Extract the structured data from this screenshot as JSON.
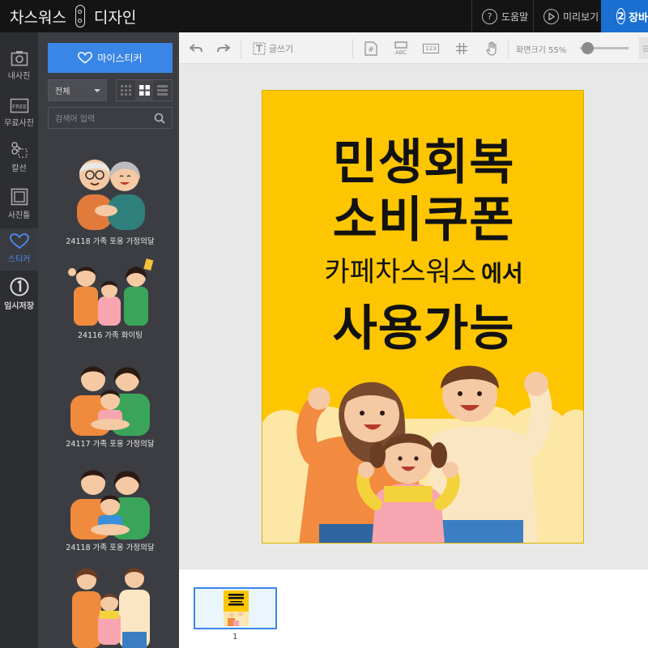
{
  "app": {
    "brand_left": "차스워스",
    "brand_right": "디자인"
  },
  "topbar": {
    "help_label": "도움말",
    "help_icon": "?",
    "preview_label": "미리보기",
    "step2_number": "2",
    "step2_label": "장바"
  },
  "rail": {
    "items": [
      {
        "label": "내사진",
        "icon": "camera-icon"
      },
      {
        "label": "무료사진",
        "icon": "free-photo-icon"
      },
      {
        "label": "칼선",
        "icon": "scissors-icon"
      },
      {
        "label": "사진틀",
        "icon": "frame-icon"
      },
      {
        "label": "스티커",
        "icon": "heart-icon"
      },
      {
        "label": "임시저장",
        "icon": "number-one-icon"
      }
    ],
    "active_index": 4
  },
  "panel": {
    "my_sticker_label": "마이스티커",
    "filter_value": "전체",
    "search_placeholder": "검색어 입력",
    "stickers": [
      {
        "caption": "24118 가족 포옹 가정의달"
      },
      {
        "caption": "24116 가족 화이팅"
      },
      {
        "caption": "24117 가족 포옹 가정의달"
      },
      {
        "caption": "24118 가족 포옹 가정의달"
      },
      {
        "caption": ""
      }
    ]
  },
  "toolbar": {
    "text_tool_label": "글쓰기",
    "abc_label": "ABC",
    "num_label": "123",
    "zoom_label": "화면크기",
    "zoom_value": "55%",
    "zoom_fraction": 0.1
  },
  "poster": {
    "line1": "민생회복",
    "line2": "소비쿠폰",
    "line3_main": "카페차스워스",
    "line3_suffix": "에서",
    "line4": "사용가능",
    "bg_color": "#fec600"
  },
  "pages": {
    "current": "1"
  },
  "colors": {
    "accent": "#3a86e6",
    "step_blue": "#1b6fd1",
    "topbar": "#141414",
    "panel": "#3b3d42"
  }
}
